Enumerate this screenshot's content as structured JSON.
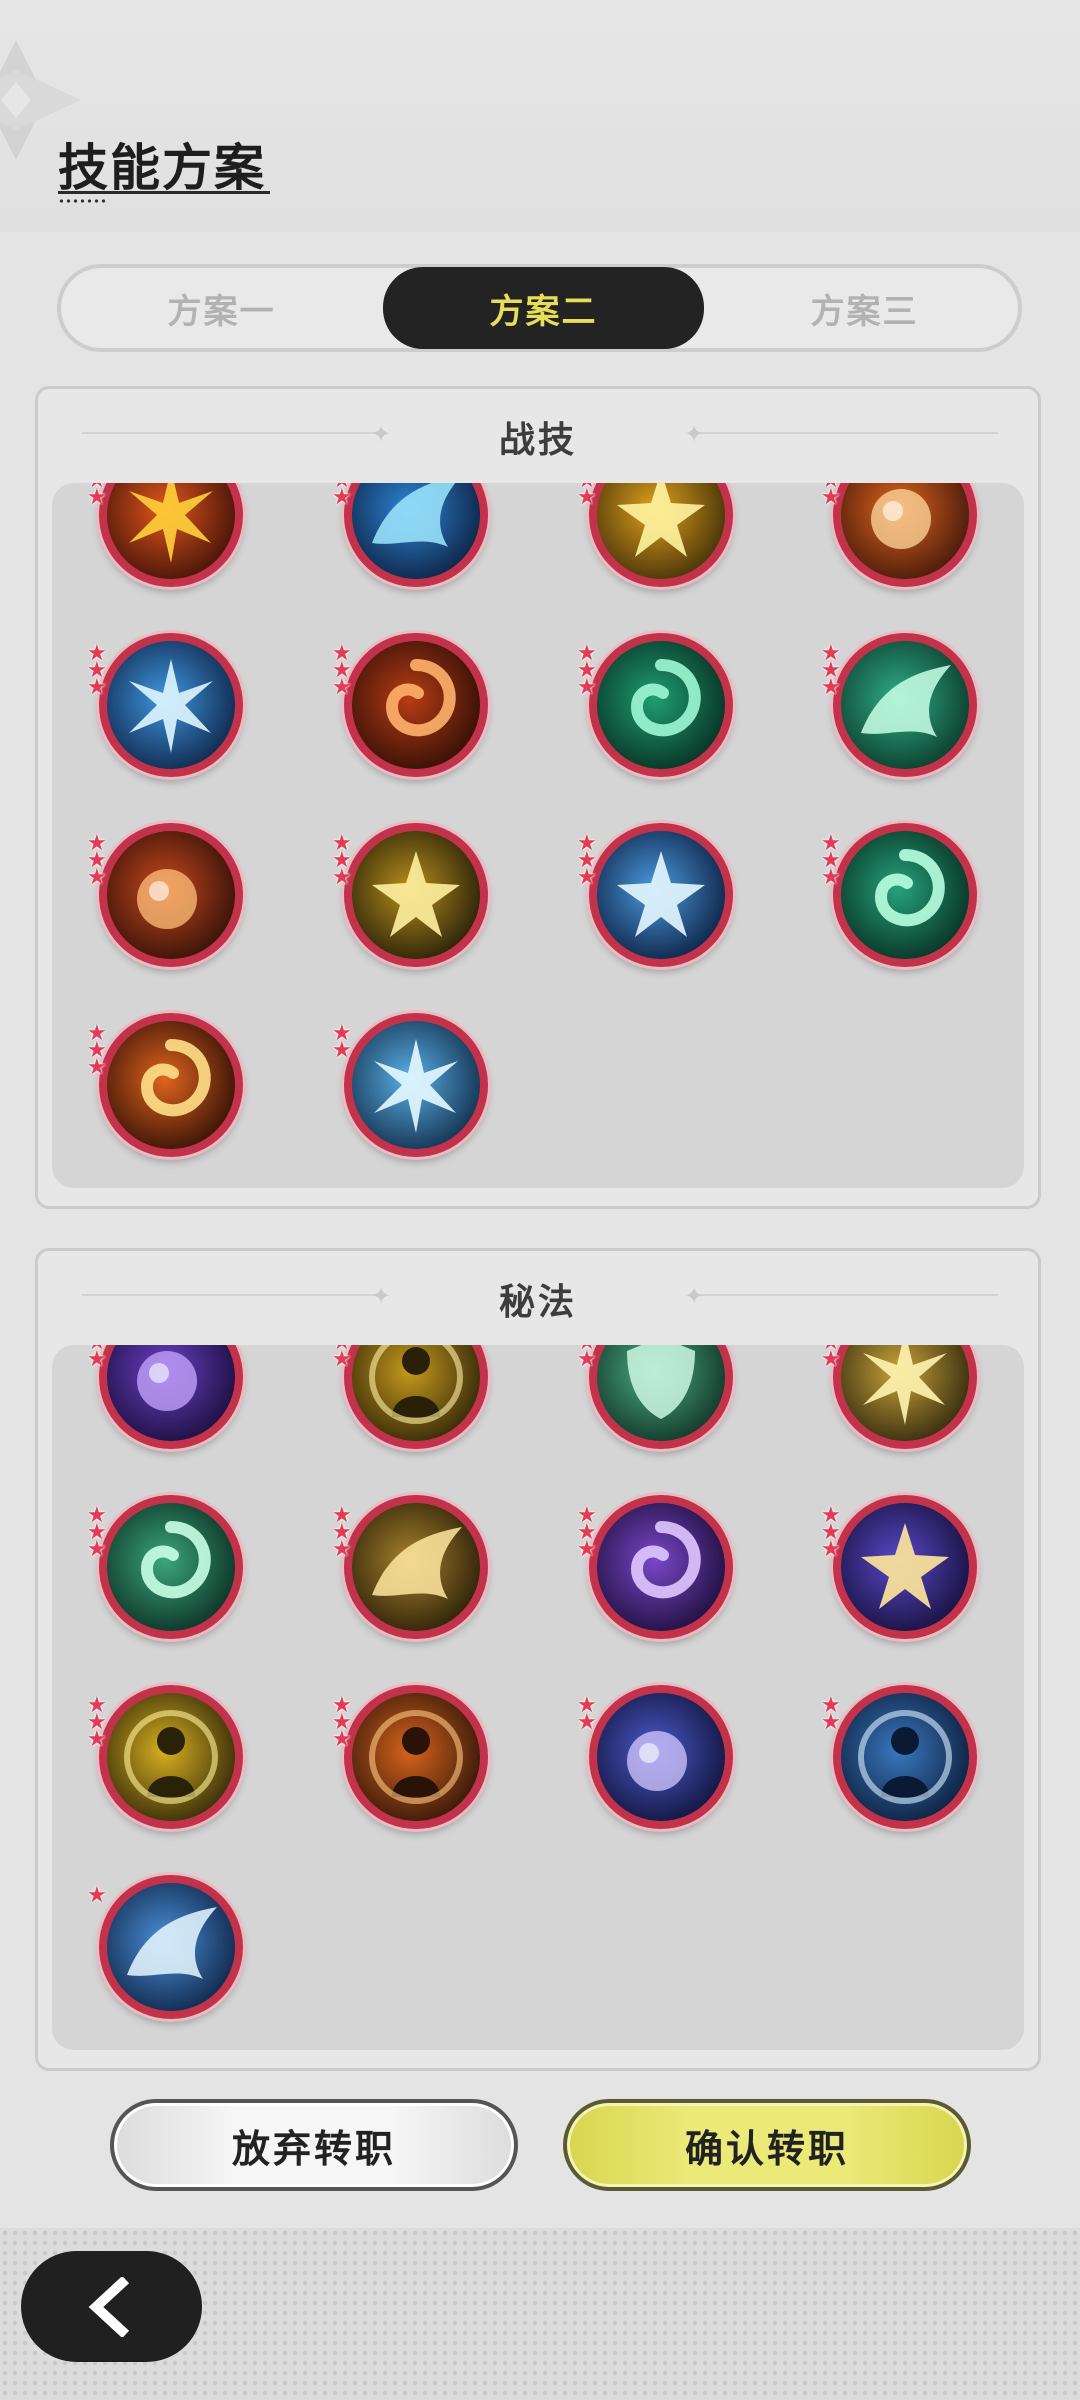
{
  "header": {
    "title": "技能方案"
  },
  "tabs": [
    {
      "label": "方案一",
      "selected": false
    },
    {
      "label": "方案二",
      "selected": true
    },
    {
      "label": "方案三",
      "selected": false
    }
  ],
  "sections": {
    "combat": {
      "title": "战技",
      "skills": [
        {
          "name": "fire-burst-icon",
          "stars": 3
        },
        {
          "name": "water-splash-icon",
          "stars": 3
        },
        {
          "name": "golden-star-icon",
          "stars": 3
        },
        {
          "name": "fire-orb-icon",
          "stars": 3
        },
        {
          "name": "ice-burst-icon",
          "stars": 3
        },
        {
          "name": "fire-swirl-icon",
          "stars": 3
        },
        {
          "name": "wind-vortex-icon",
          "stars": 3
        },
        {
          "name": "wind-slash-icon",
          "stars": 3
        },
        {
          "name": "meteor-icon",
          "stars": 3
        },
        {
          "name": "constellation-icon",
          "stars": 3
        },
        {
          "name": "ice-crystal-icon",
          "stars": 3
        },
        {
          "name": "wind-arrow-icon",
          "stars": 3
        },
        {
          "name": "fire-vortex-icon",
          "stars": 3
        },
        {
          "name": "ice-spikes-icon",
          "stars": 2
        }
      ]
    },
    "arcane": {
      "title": "秘法",
      "skills": [
        {
          "name": "arcane-potion-icon",
          "stars": 3
        },
        {
          "name": "golden-figure-icon",
          "stars": 3
        },
        {
          "name": "green-shield-icon",
          "stars": 3
        },
        {
          "name": "golden-light-icon",
          "stars": 3
        },
        {
          "name": "green-chain-icon",
          "stars": 3
        },
        {
          "name": "golden-slash-icon",
          "stars": 3
        },
        {
          "name": "purple-swirl-icon",
          "stars": 3
        },
        {
          "name": "sparkle-portal-icon",
          "stars": 3
        },
        {
          "name": "golden-aura-icon",
          "stars": 3
        },
        {
          "name": "fire-spirit-icon",
          "stars": 3
        },
        {
          "name": "time-clock-icon",
          "stars": 2
        },
        {
          "name": "snow-figure-icon",
          "stars": 2
        },
        {
          "name": "ice-wing-icon",
          "stars": 1
        }
      ]
    }
  },
  "buttons": {
    "abandon_label": "放弃转职",
    "confirm_label": "确认转职",
    "back_icon": "chevron-left-icon"
  },
  "colors": {
    "tab_active_bg": "#232323",
    "tab_active_text": "#e6de58",
    "icon_ring": "#c2324a",
    "confirm_button": "#ebe978"
  }
}
